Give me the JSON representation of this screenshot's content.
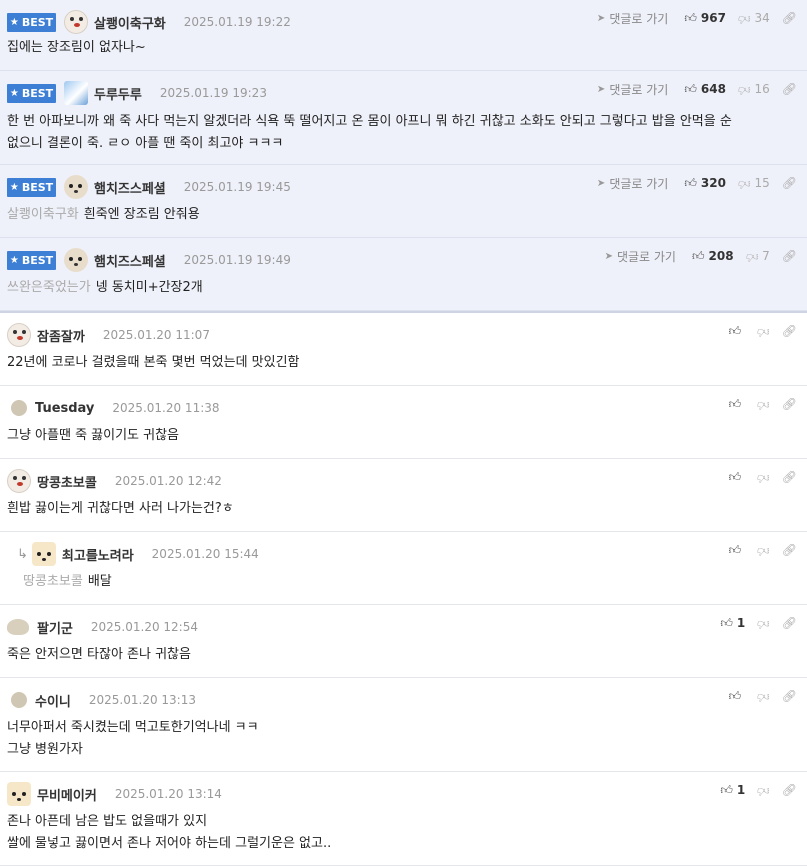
{
  "best_label": "BEST",
  "goto_label": "댓글로 가기",
  "best_comments": [
    {
      "nick": "살쾡이축구화",
      "date": "2025.01.19 19:22",
      "up": "967",
      "down": "34",
      "avatar": "dog",
      "lines": [
        "집에는 장조림이 없자나~"
      ]
    },
    {
      "nick": "두루두루",
      "date": "2025.01.19 19:23",
      "up": "648",
      "down": "16",
      "avatar": "sky",
      "lines": [
        "한 번 아파보니까 왜 죽 사다 먹는지 알겠더라 식욕 뚝 떨어지고 온 몸이 아프니 뭐 하긴 귀찮고 소화도 안되고 그렇다고 밥을 안먹을 순",
        "없으니 결론이 죽. ㄹㅇ 아플 땐 죽이 최고야 ㅋㅋㅋ"
      ]
    },
    {
      "nick": "햄치즈스페셜",
      "date": "2025.01.19 19:45",
      "up": "320",
      "down": "15",
      "avatar": "pup",
      "quote": "살쾡이축구화",
      "lines": [
        "흰죽엔 장조림 안줘용"
      ]
    },
    {
      "nick": "햄치즈스페셜",
      "date": "2025.01.19 19:49",
      "up": "208",
      "down": "7",
      "avatar": "pup",
      "quote": "쓰완은죽었는가",
      "lines": [
        "넹 동치미+간장2개"
      ]
    }
  ],
  "comments": [
    {
      "nick": "잠좀잘까",
      "date": "2025.01.20 11:07",
      "up": "",
      "avatar": "dog",
      "lines": [
        "22년에 코로나 걸렸을때 본죽 몇번 먹었는데 맛있긴함"
      ]
    },
    {
      "nick": "Tuesday",
      "date": "2025.01.20 11:38",
      "up": "",
      "avatar": "plain",
      "lines": [
        "그냥 아플땐 죽 끓이기도 귀찮음"
      ]
    },
    {
      "nick": "땅콩초보콜",
      "date": "2025.01.20 12:42",
      "up": "",
      "avatar": "dog",
      "lines": [
        "흰밥 끓이는게 귀찮다면 사러 나가는건?ㅎ"
      ]
    },
    {
      "nick": "최고를노려라",
      "date": "2025.01.20 15:44",
      "up": "",
      "avatar": "fox",
      "reply": true,
      "quote": "땅콩초보콜",
      "lines": [
        "배달"
      ]
    },
    {
      "nick": "팔기군",
      "date": "2025.01.20 12:54",
      "up": "1",
      "avatar": "pot",
      "lines": [
        "죽은 안저으면 타잖아 존나 귀찮음"
      ]
    },
    {
      "nick": "수이니",
      "date": "2025.01.20 13:13",
      "up": "",
      "avatar": "plain",
      "lines": [
        "너무아퍼서 죽시켰는데 먹고토한기억나네 ㅋㅋ",
        "그냥 병원가자"
      ]
    },
    {
      "nick": "무비메이커",
      "date": "2025.01.20 13:14",
      "up": "1",
      "avatar": "fox",
      "lines": [
        "존나 아픈데 남은 밥도 없을때가 있지",
        "쌀에 물넣고 끓이면서 존나 저어야 하는데 그럴기운은 없고.."
      ]
    }
  ]
}
